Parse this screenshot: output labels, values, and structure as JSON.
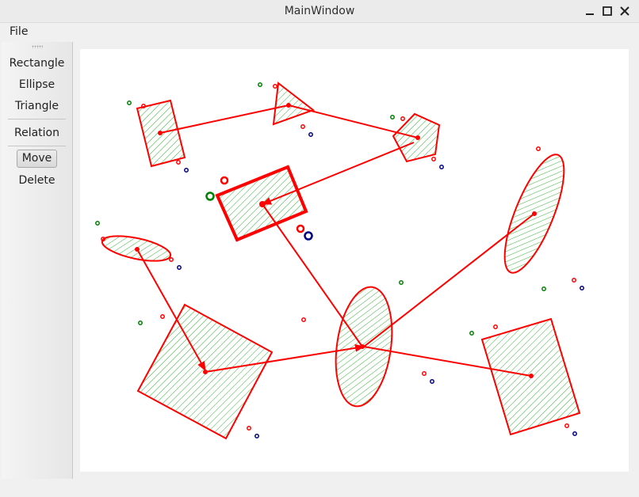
{
  "window": {
    "title": "MainWindow"
  },
  "menu": {
    "file": "File"
  },
  "toolbar": {
    "rectangle": "Rectangle",
    "ellipse": "Ellipse",
    "triangle": "Triangle",
    "relation": "Relation",
    "move": "Move",
    "delete": "Delete",
    "active_tool": "Move"
  },
  "canvas": {
    "shape_stroke": "#ff0000",
    "hatch_color": "#00a000",
    "shape_kinds": [
      "rectangle",
      "triangle",
      "pentagon",
      "rectangle-selected",
      "ellipse",
      "ellipse",
      "rectangle",
      "ellipse",
      "rectangle"
    ]
  },
  "colors": {
    "titlebar": "#ebebeb",
    "toolbar": "#ededed",
    "canvas_background": "#ffffff",
    "handle_green": "#008000",
    "handle_red": "#ff0000",
    "handle_blue": "#000080"
  }
}
